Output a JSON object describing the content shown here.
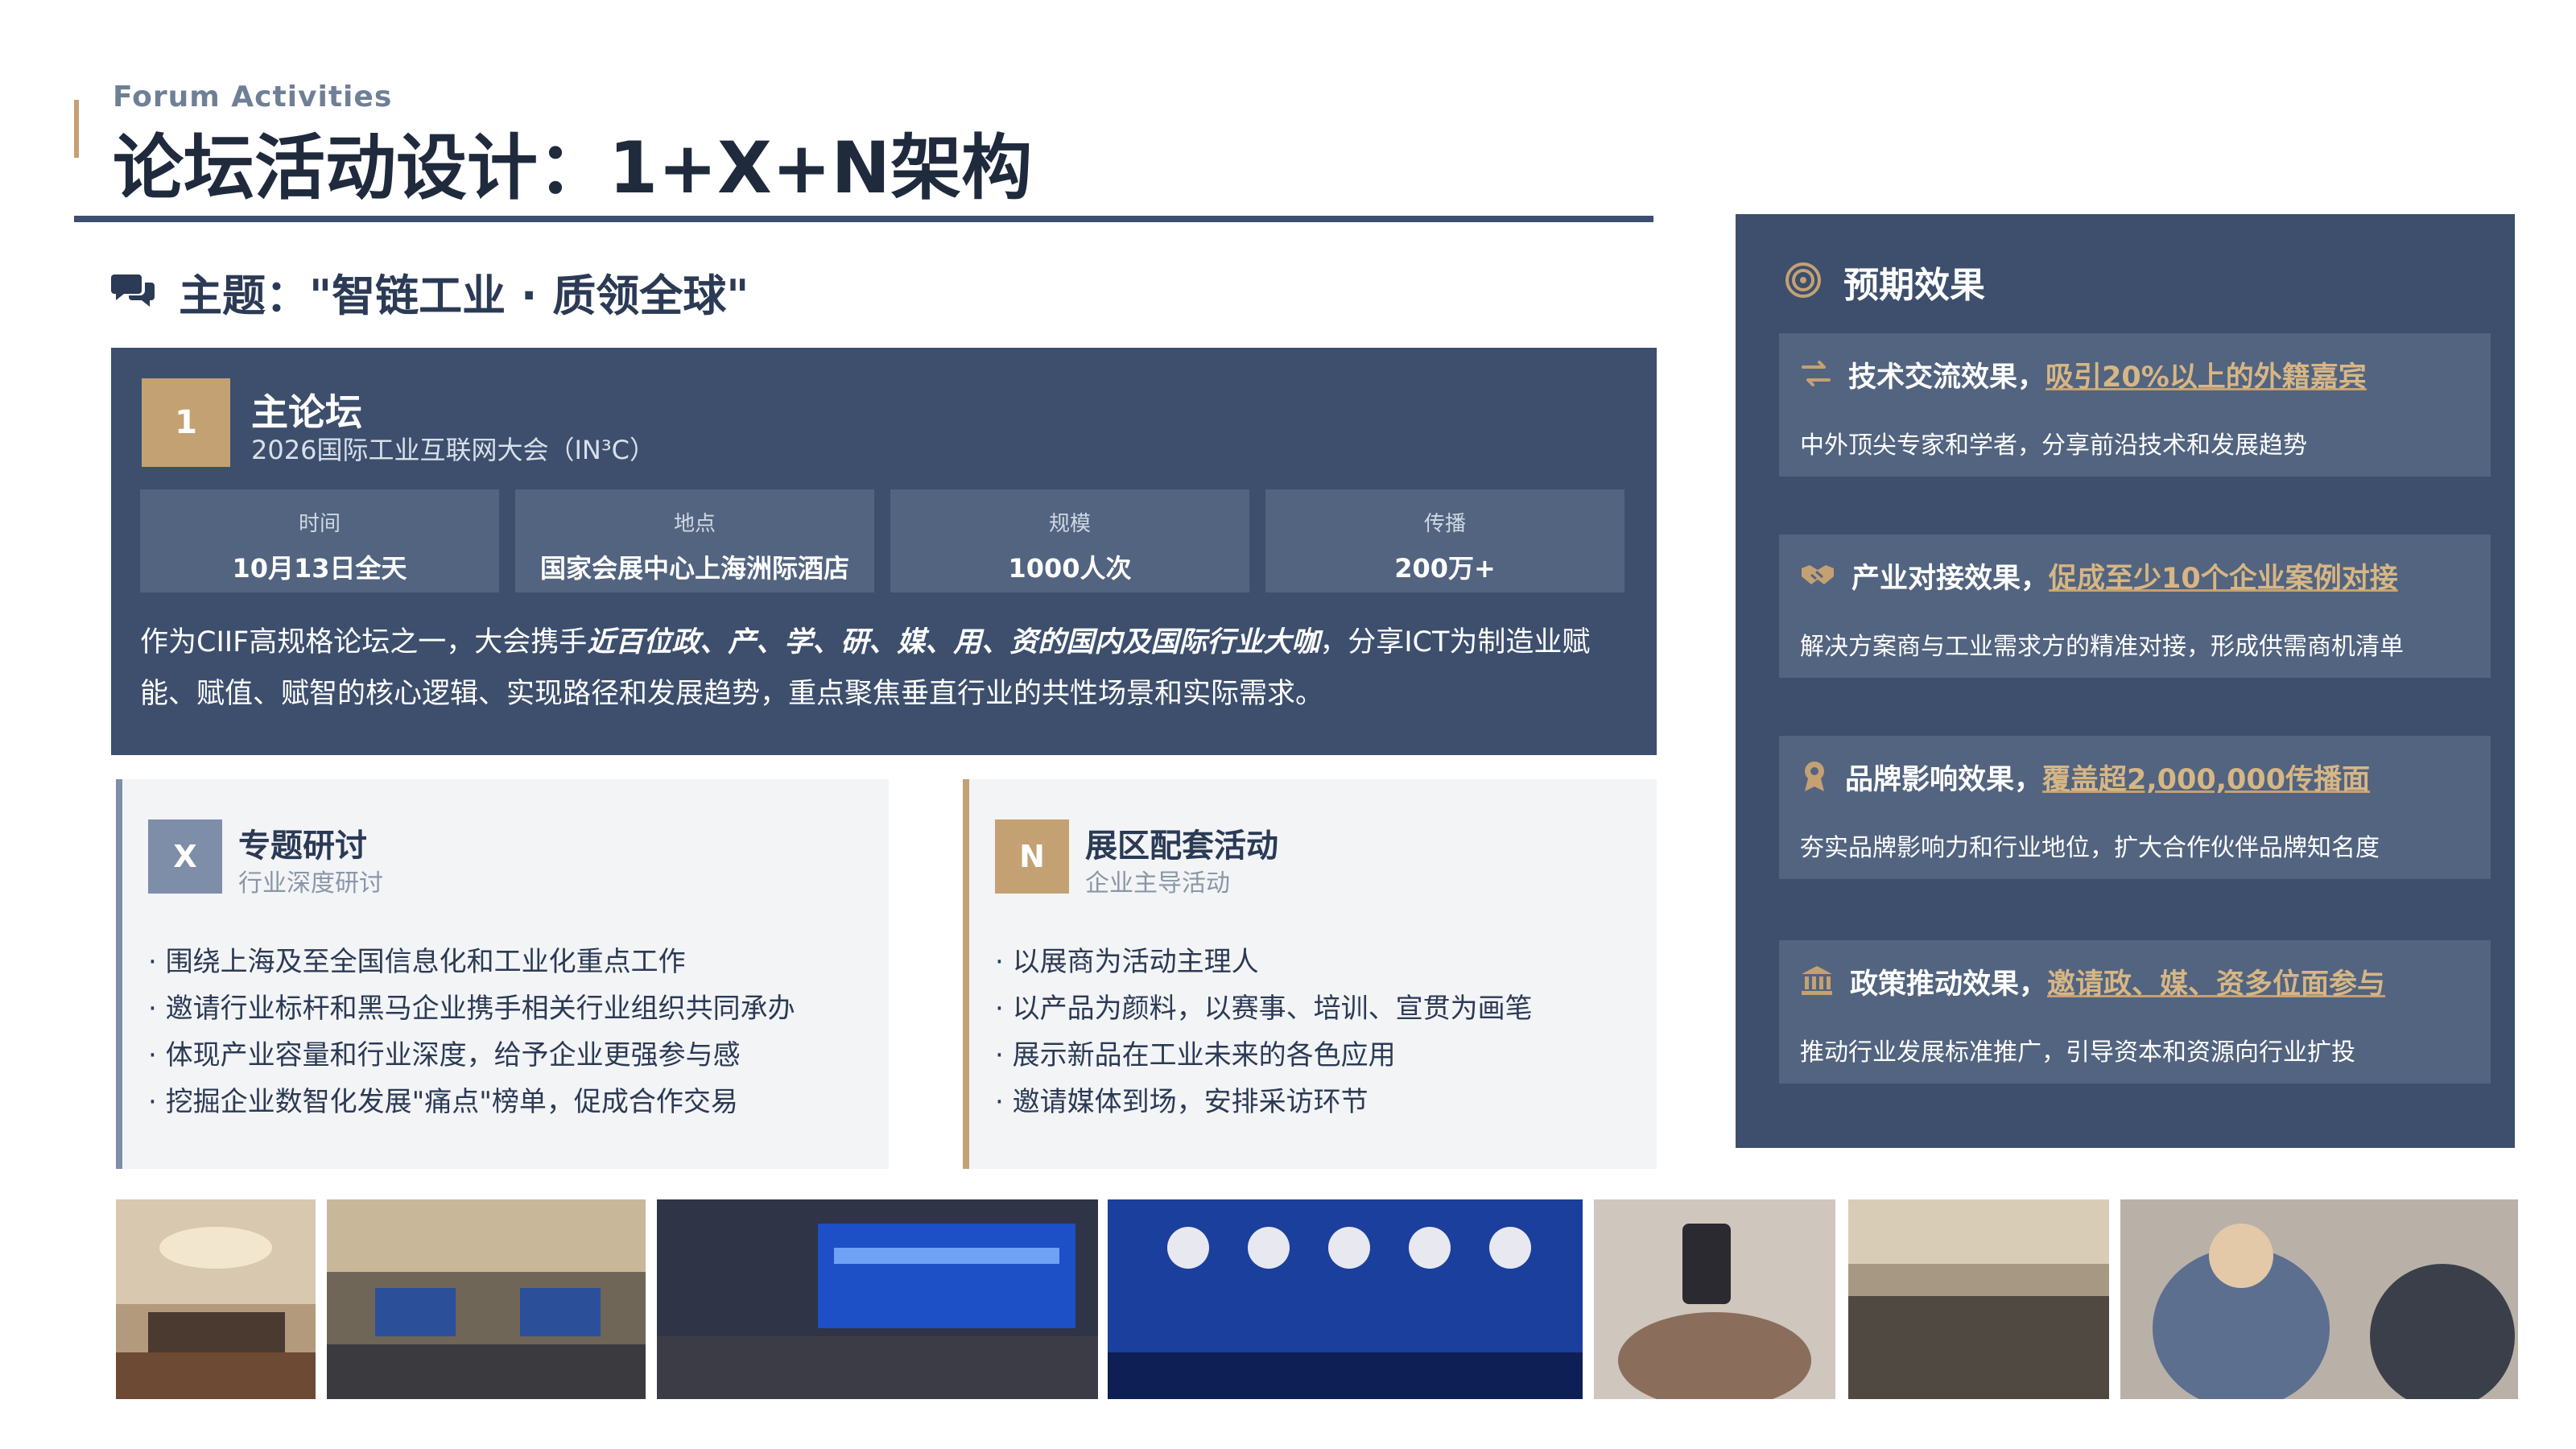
{
  "header": {
    "kicker": "Forum Activities",
    "title": "论坛活动设计：1+X+N架构"
  },
  "theme": "主题：\"智链工业 · 质领全球\"",
  "main_forum": {
    "badge": "1",
    "title": "主论坛",
    "subtitle": "2026国际工业互联网大会（IN³C）",
    "stats": [
      {
        "label": "时间",
        "value": "10月13日全天"
      },
      {
        "label": "地点",
        "value": "国家会展中心上海洲际酒店"
      },
      {
        "label": "规模",
        "value": "1000人次"
      },
      {
        "label": "传播",
        "value": "200万+"
      }
    ],
    "desc_before": "作为CIIF高规格论坛之一，大会携手",
    "desc_emphasis": "近百位政、产、学、研、媒、用、资的国内及国际行业大咖",
    "desc_after": "，分享ICT为制造业赋能、赋值、赋智的核心逻辑、实现路径和发展趋势，重点聚焦垂直行业的共性场景和实际需求。"
  },
  "x_card": {
    "badge": "X",
    "title": "专题研讨",
    "subtitle": "行业深度研讨",
    "items": [
      "· 围绕上海及至全国信息化和工业化重点工作",
      "· 邀请行业标杆和黑马企业携手相关行业组织共同承办",
      "· 体现产业容量和行业深度，给予企业更强参与感",
      "· 挖掘企业数智化发展\"痛点\"榜单，促成合作交易"
    ]
  },
  "n_card": {
    "badge": "N",
    "title": "展区配套活动",
    "subtitle": "企业主导活动",
    "items": [
      "· 以展商为活动主理人",
      "· 以产品为颜料，以赛事、培训、宣贯为画笔",
      "· 展示新品在工业未来的各色应用",
      "· 邀请媒体到场，安排采访环节"
    ]
  },
  "effects": {
    "heading": "预期效果",
    "items": [
      {
        "icon": "exchange-icon",
        "name": "技术交流效果，",
        "highlight": "吸引20%以上的外籍嘉宾",
        "desc": "中外顶尖专家和学者，分享前沿技术和发展趋势"
      },
      {
        "icon": "handshake-icon",
        "name": "产业对接效果，",
        "highlight": "促成至少10个企业案例对接",
        "desc": "解决方案商与工业需求方的精准对接，形成供需商机清单"
      },
      {
        "icon": "award-icon",
        "name": "品牌影响效果，",
        "highlight": "覆盖超2,000,000传播面",
        "desc": "夯实品牌影响力和行业地位，扩大合作伙伴品牌知名度"
      },
      {
        "icon": "landmark-icon",
        "name": "政策推动效果，",
        "highlight": "邀请政、媒、资多位面参与",
        "desc": "推动行业发展标准推广，引导资本和资源向行业扩投"
      }
    ]
  },
  "colors": {
    "navy": "#3d4f6d",
    "navy_light": "#52647f",
    "gold": "#c4a173",
    "gray_badge": "#7e8ea8"
  }
}
